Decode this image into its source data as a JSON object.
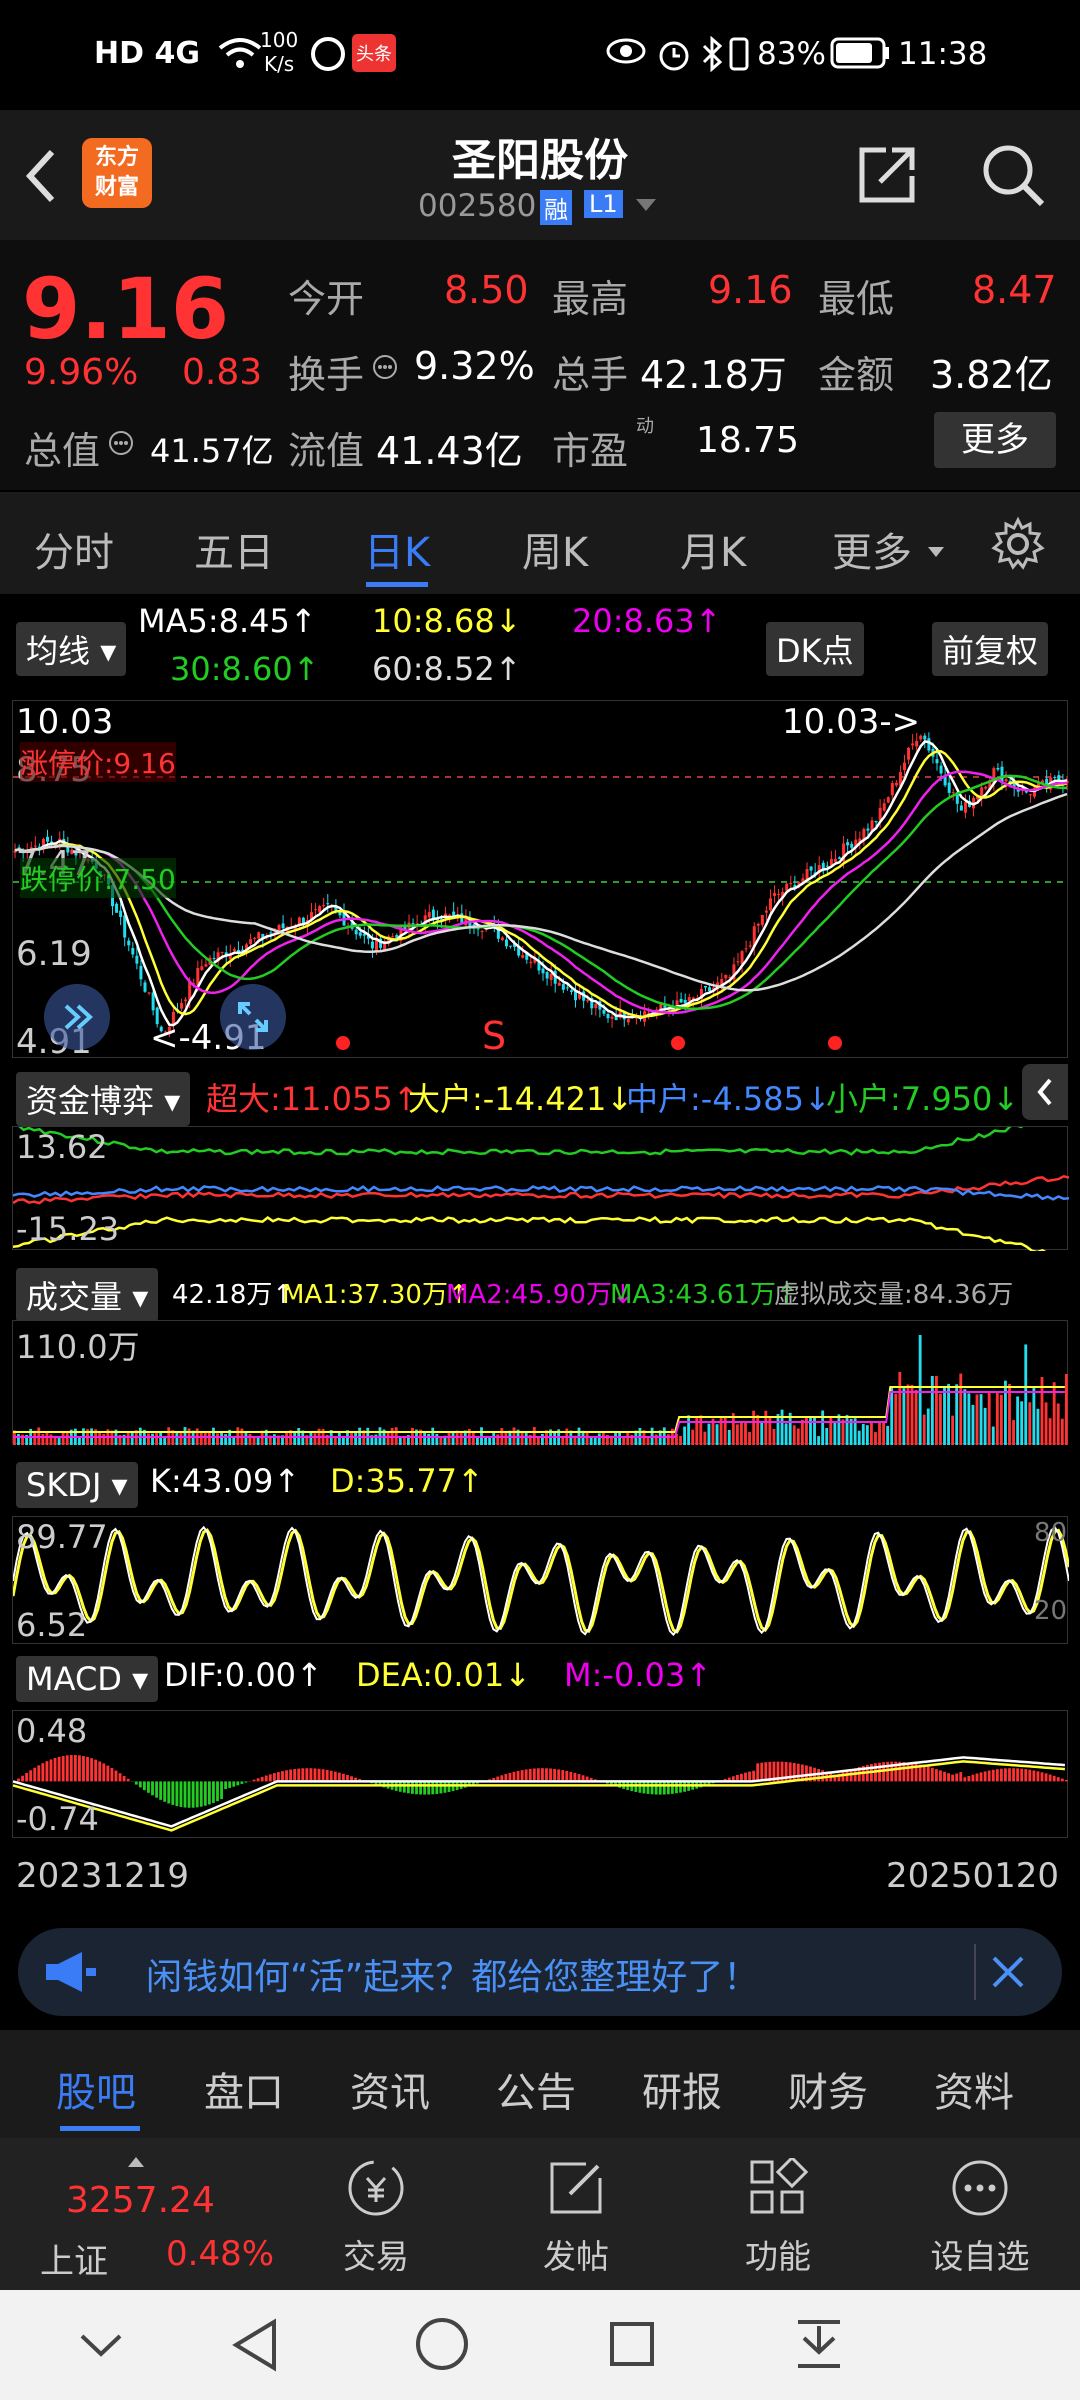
{
  "statusbar": {
    "left_icons": "HD 4G",
    "net_speed_value": "100",
    "net_speed_unit": "K/s",
    "news_badge": "头条",
    "battery": "83%",
    "time": "11:38"
  },
  "header": {
    "app_logo": "东方\n财富",
    "stock_name": "圣阳股份",
    "stock_code": "002580",
    "margin_badge": "融",
    "level_badge": "L1"
  },
  "quote": {
    "price": "9.16",
    "change_pct": "9.96%",
    "change_abs": "0.83",
    "total_value_label": "总值",
    "total_value": "41.57亿",
    "open_label": "今开",
    "open": "8.50",
    "high_label": "最高",
    "high": "9.16",
    "low_label": "最低",
    "low": "8.47",
    "turnover_label": "换手",
    "turnover": "9.32%",
    "volume_label": "总手",
    "volume": "42.18万",
    "amount_label": "金额",
    "amount": "3.82亿",
    "float_label": "流值",
    "float_value": "41.43亿",
    "pe_label": "市盈",
    "pe_sup": "动",
    "pe": "18.75",
    "more_button": "更多"
  },
  "period_tabs": [
    "分时",
    "五日",
    "日K",
    "周K",
    "月K",
    "更多"
  ],
  "active_tab": "日K",
  "kline": {
    "ma_selector": "均线",
    "ma5": "MA5:8.45↑",
    "ma10": "10:8.68↓",
    "ma20": "20:8.63↑",
    "ma30": "30:8.60↑",
    "ma60": "60:8.52↑",
    "dk_button": "DK点",
    "adjust_button": "前复权",
    "y_top": "10.03",
    "y_2": "8.75",
    "y_3": "7.47",
    "y_4": "6.19",
    "y_bottom": "4.91",
    "limit_up": "涨停价:9.16",
    "limit_down": "跌停价:7.50",
    "max_marker": "10.03->",
    "min_marker": "<-4.91",
    "s_marker": "S"
  },
  "fund_flow": {
    "selector": "资金博弈",
    "super_large": "超大:11.055↑",
    "large": "大户:-14.421↓",
    "medium": "中户:-4.585↓",
    "small": "小户:7.950↓",
    "y_top": "13.62",
    "y_bottom": "-15.23"
  },
  "volume_panel": {
    "selector": "成交量",
    "current": "42.18万↑",
    "ma1": "MA1:37.30万↑",
    "ma2": "MA2:45.90万↓",
    "ma3": "MA3:43.61万↑",
    "virtual": "虚拟成交量:84.36万",
    "y_top": "110.0万"
  },
  "skdj": {
    "selector": "SKDJ",
    "k": "K:43.09↑",
    "d": "D:35.77↑",
    "y_top": "89.77",
    "y_bottom": "6.52",
    "right_top": "80",
    "right_bottom": "20"
  },
  "macd": {
    "selector": "MACD",
    "dif": "DIF:0.00↑",
    "dea": "DEA:0.01↓",
    "m": "M:-0.03↑",
    "y_top": "0.48",
    "y_bottom": "-0.74"
  },
  "date_range": {
    "start": "20231219",
    "end": "20250120"
  },
  "banner": {
    "text": "闲钱如何“活”起来？都给您整理好了！"
  },
  "bottom_tabs": [
    "股吧",
    "盘口",
    "资讯",
    "公告",
    "研报",
    "财务",
    "资料"
  ],
  "active_bottom_tab": "股吧",
  "dock": {
    "index_value": "3257.24",
    "index_name": "上证",
    "index_change": "0.48%",
    "trade": "交易",
    "post": "发帖",
    "function": "功能",
    "watchlist": "设自选"
  },
  "colors": {
    "up": "#ff3333",
    "down": "#22cc22",
    "accent_blue": "#3a7cf5",
    "ma5": "#ffffff",
    "ma10": "#ffff33",
    "ma20": "#ee22ee",
    "ma30": "#22cc22",
    "ma60": "#dddddd"
  }
}
